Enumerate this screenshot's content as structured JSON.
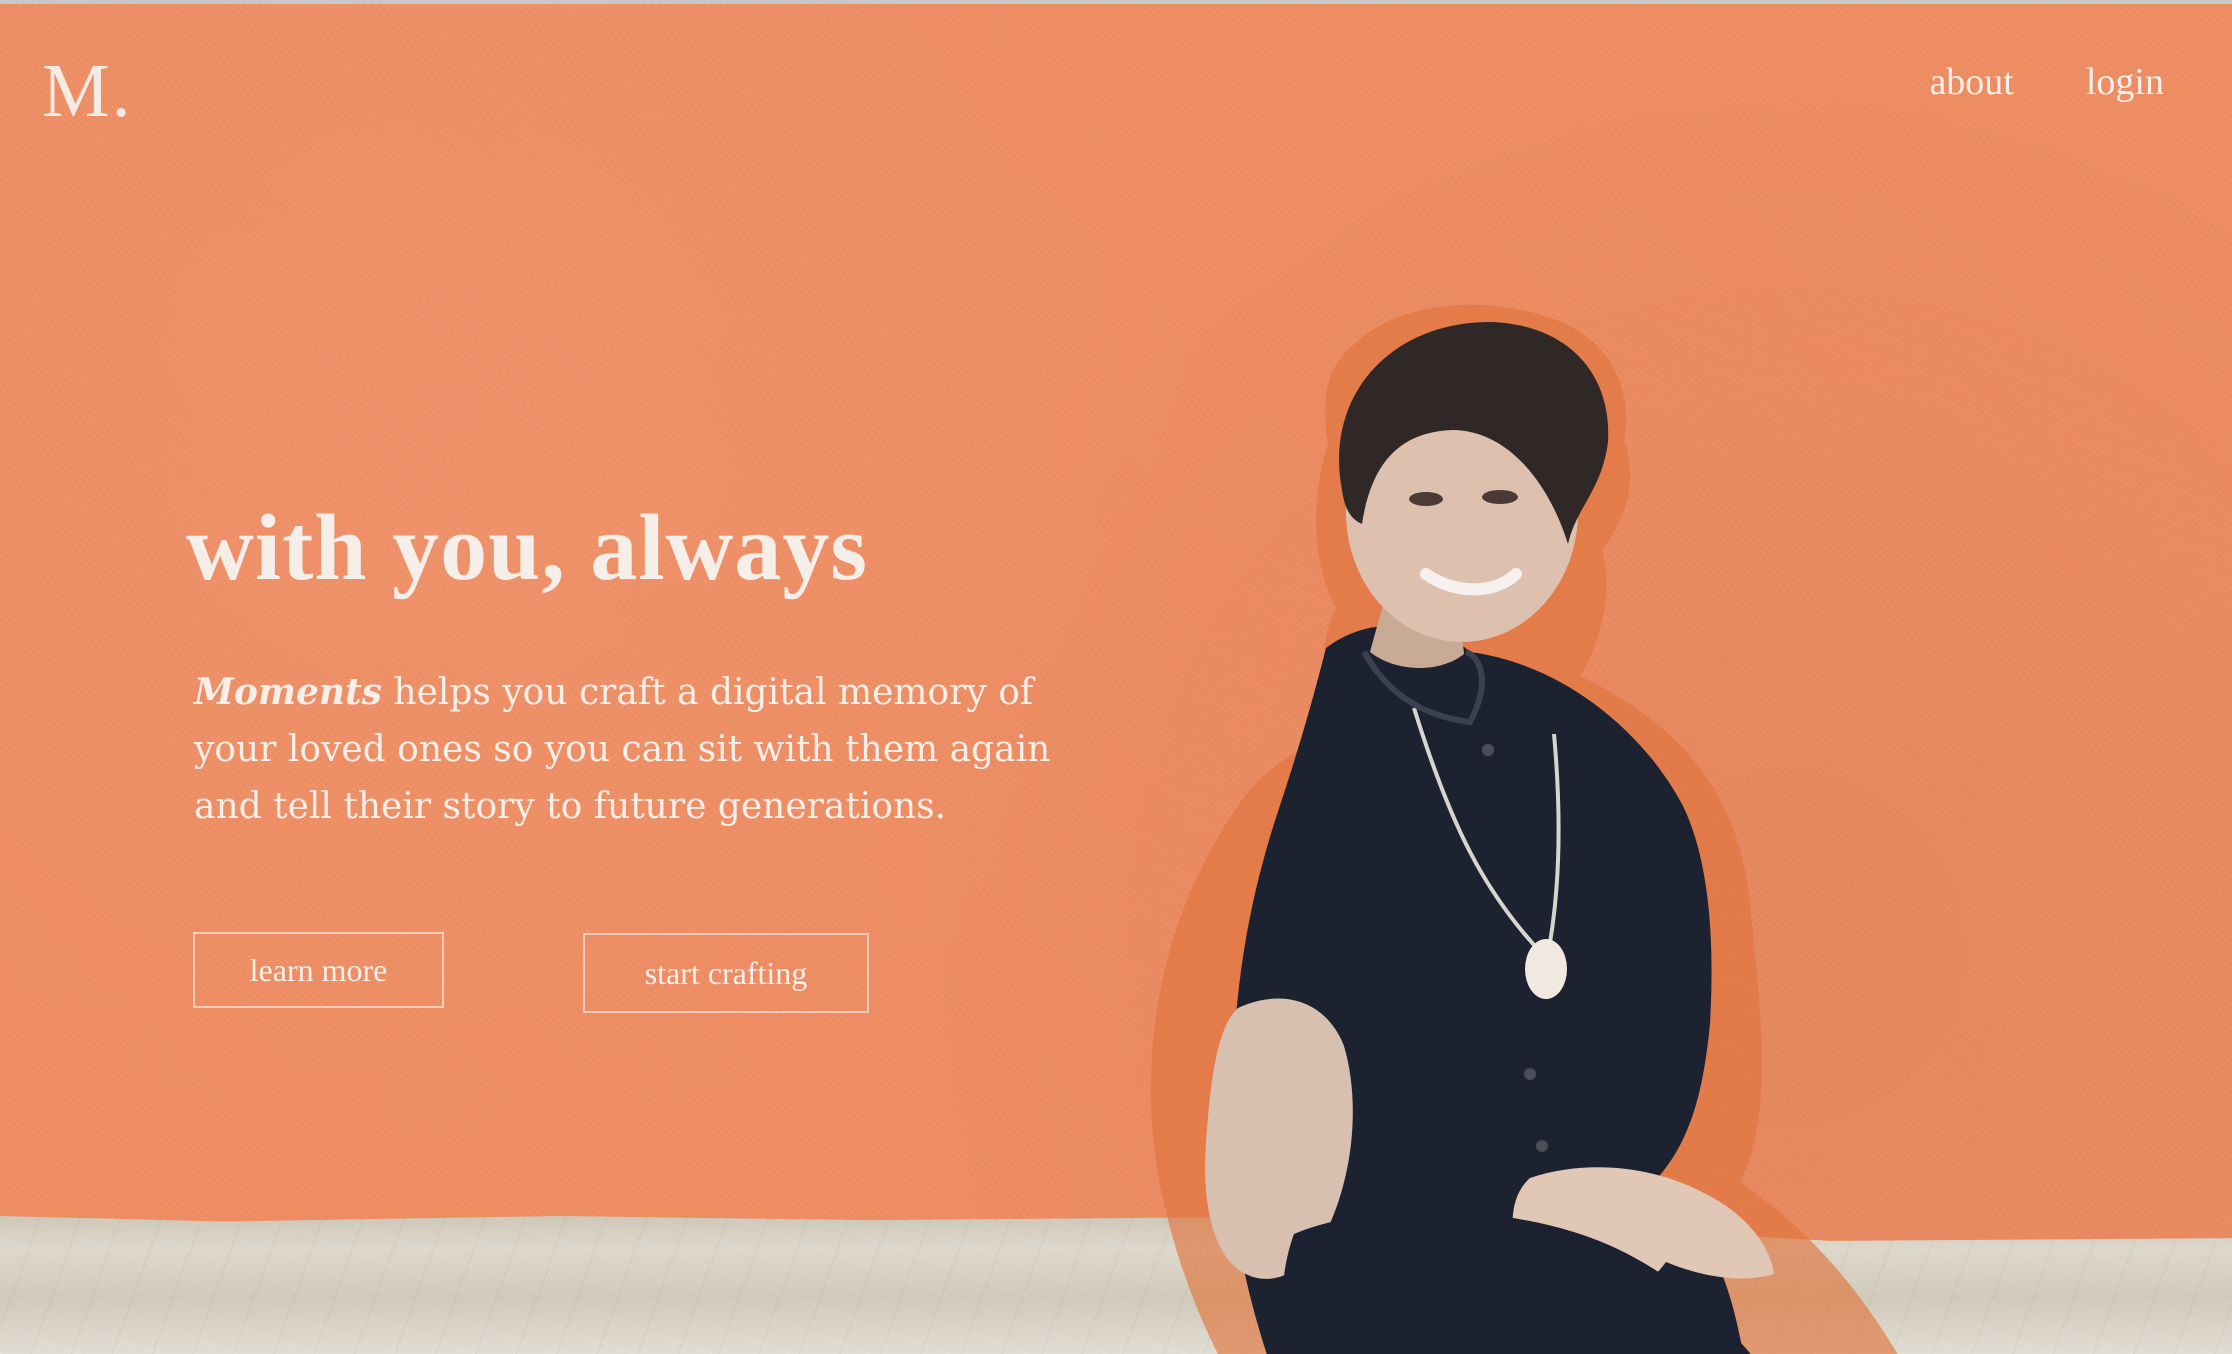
{
  "brand": {
    "logo": "M."
  },
  "nav": {
    "about": "about",
    "login": "login"
  },
  "hero": {
    "title": "with you, always",
    "body_brand": "Moments",
    "body_text": " helps you craft a digital memory of your loved ones so you can sit with them again and tell their story to future generations."
  },
  "buttons": {
    "learn_more": "learn more",
    "start_crafting": "start crafting"
  },
  "colors": {
    "background": "#ee8c62",
    "text": "#f6efe9"
  },
  "icons": {
    "logo": "monogram-logo",
    "portrait": "woman-portrait"
  }
}
